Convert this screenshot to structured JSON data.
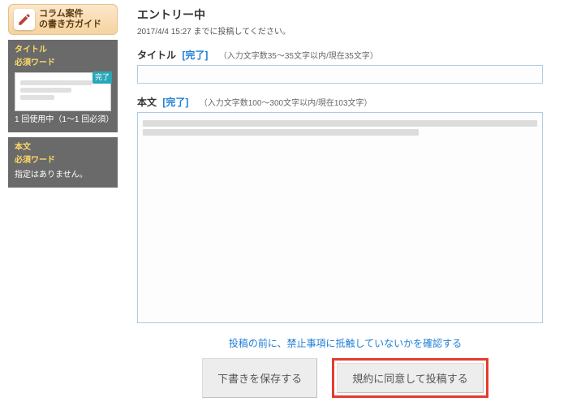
{
  "guide": {
    "line1": "コラム案件",
    "line2": "の書き方ガイド"
  },
  "sidebar": {
    "titlePanel": {
      "heading": "タイトル",
      "sub": "必須ワード",
      "doneBadge": "完了",
      "count": "1 回使用中（1～1 回必須）"
    },
    "bodyPanel": {
      "heading": "本文",
      "sub": "必須ワード",
      "desc": "指定はありません。"
    }
  },
  "main": {
    "statusTitle": "エントリー中",
    "statusSub": "2017/4/4 15:27 までに投稿してください。",
    "titleField": {
      "label": "タイトル",
      "done": "[完了]",
      "hint": "（入力文字数35～35文字以内/現在35文字）",
      "value": ""
    },
    "bodyField": {
      "label": "本文",
      "done": "[完了]",
      "hint": "（入力文字数100～300文字以内/現在103文字）"
    },
    "warnLink": "投稿の前に、禁止事項に抵触していないかを確認する",
    "buttons": {
      "draft": "下書きを保存する",
      "submit": "規約に同意して投稿する"
    }
  }
}
